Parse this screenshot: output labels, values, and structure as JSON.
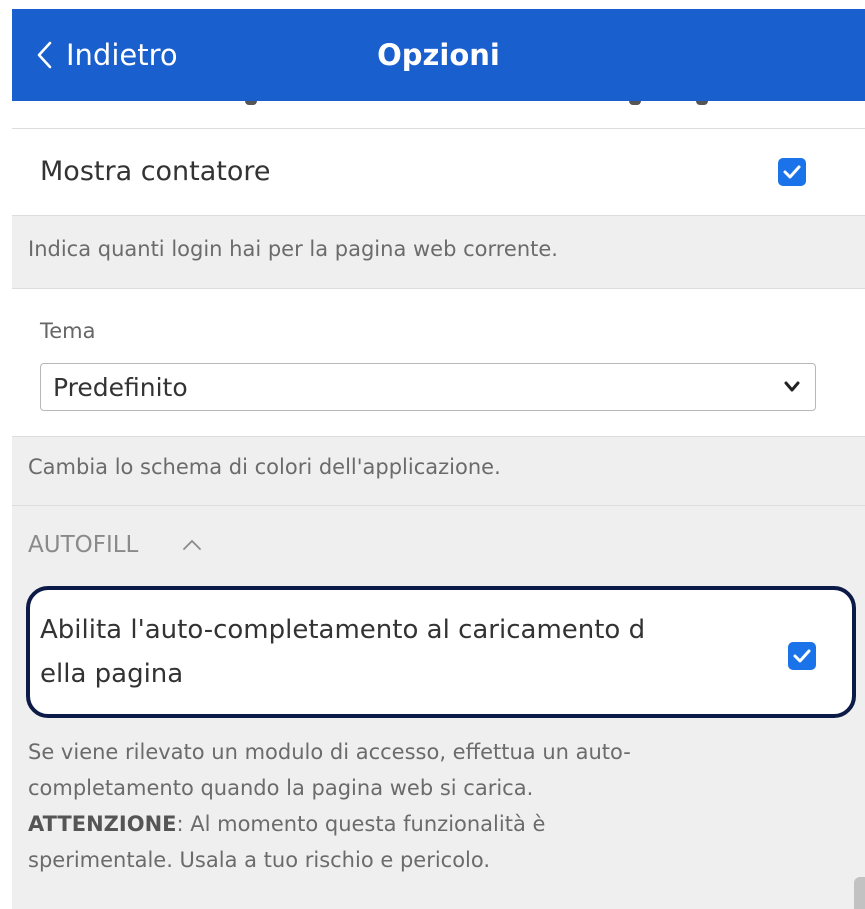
{
  "header": {
    "back_label": "Indietro",
    "title": "Opzioni"
  },
  "show_counter": {
    "label": "Mostra contatore",
    "checked": true,
    "description": "Indica quanti login hai per la pagina web corrente."
  },
  "theme": {
    "label": "Tema",
    "selected": "Predefinito",
    "description": "Cambia lo schema di colori dell'applicazione."
  },
  "autofill": {
    "section_title": "AUTOFILL",
    "expanded": true,
    "autofill_on_load": {
      "label_line1": "Abilita l'auto-completamento al caricamento d",
      "label_line2": "ella pagina",
      "checked": true,
      "description_line1": "Se viene rilevato un modulo di accesso, effettua un auto-",
      "description_line2": "completamento quando la pagina web si carica.",
      "warning_label": "ATTENZIONE",
      "warning_line1": ": Al momento questa funzionalità è",
      "warning_line2": "sperimentale. Usala a tuo rischio e pericolo."
    }
  },
  "colors": {
    "header_bg": "#1a5fce",
    "checkbox": "#1a73e8",
    "highlight_border": "#0b1a46"
  },
  "icons": {
    "back": "chevron-left-icon",
    "select": "chevron-down-icon",
    "section_toggle": "chevron-up-icon",
    "check": "checkmark-icon"
  }
}
